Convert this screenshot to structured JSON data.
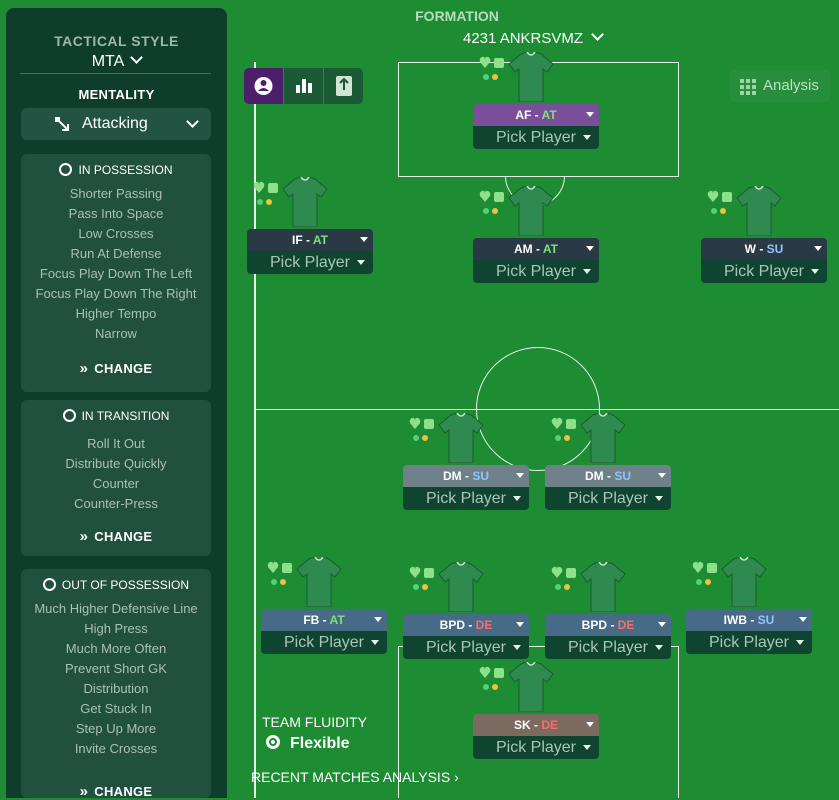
{
  "sidebar": {
    "tactical_style_title": "TACTICAL STYLE",
    "tactical_style_value": "MTA",
    "mentality_title": "MENTALITY",
    "mentality_value": "Attacking",
    "in_possession": {
      "title": "IN POSSESSION",
      "items": [
        "Shorter Passing",
        "Pass Into Space",
        "Low Crosses",
        "Run At Defense",
        "Focus Play Down The Left",
        "Focus Play Down The Right",
        "Higher Tempo",
        "Narrow"
      ],
      "change_label": "CHANGE"
    },
    "in_transition": {
      "title": "IN TRANSITION",
      "items": [
        "Roll It Out",
        "Distribute Quickly",
        "Counter",
        "Counter-Press"
      ],
      "change_label": "CHANGE"
    },
    "out_of_possession": {
      "title": "OUT OF POSSESSION",
      "items": [
        "Much Higher Defensive Line",
        "High Press",
        "Much More Often",
        "Prevent Short GK",
        "Distribution",
        "Get Stuck In",
        "Step Up More",
        "Invite Crosses"
      ],
      "change_label": "CHANGE"
    }
  },
  "header": {
    "formation_title": "FORMATION",
    "formation_value": "4231 ANKRSVMZ"
  },
  "view_buttons": [
    "player-view",
    "stats-view",
    "info-view"
  ],
  "analysis_label": "Analysis",
  "pick_label": "Pick Player",
  "players": [
    {
      "role": "AF",
      "duty": "AT",
      "role_bg": "#7a4f9a",
      "duty_color": "#7ee07e"
    },
    {
      "role": "IF",
      "duty": "AT",
      "role_bg": "#2a3a44",
      "duty_color": "#7ee07e"
    },
    {
      "role": "AM",
      "duty": "AT",
      "role_bg": "#2a3a44",
      "duty_color": "#7ee07e"
    },
    {
      "role": "W",
      "duty": "SU",
      "role_bg": "#2a3a44",
      "duty_color": "#8ec5ff"
    },
    {
      "role": "DM",
      "duty": "SU",
      "role_bg": "#6e8088",
      "duty_color": "#8ec5ff"
    },
    {
      "role": "DM",
      "duty": "SU",
      "role_bg": "#6e8088",
      "duty_color": "#8ec5ff"
    },
    {
      "role": "FB",
      "duty": "AT",
      "role_bg": "#476a86",
      "duty_color": "#7ee07e"
    },
    {
      "role": "BPD",
      "duty": "DE",
      "role_bg": "#476a86",
      "duty_color": "#ff6a6a"
    },
    {
      "role": "BPD",
      "duty": "DE",
      "role_bg": "#476a86",
      "duty_color": "#ff6a6a"
    },
    {
      "role": "IWB",
      "duty": "SU",
      "role_bg": "#476a86",
      "duty_color": "#8ec5ff"
    },
    {
      "role": "SK",
      "duty": "DE",
      "role_bg": "#7a6a60",
      "duty_color": "#ff6a6a"
    }
  ],
  "team_fluidity_label": "TEAM FLUIDITY",
  "team_fluidity_value": "Flexible",
  "recent_matches_label": "RECENT MATCHES ANALYSIS"
}
